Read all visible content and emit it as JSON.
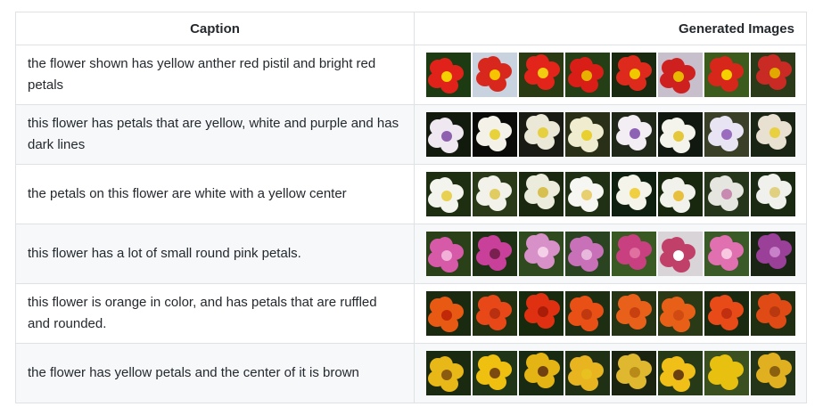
{
  "table": {
    "header_caption": "Caption",
    "header_images": "Generated Images",
    "rows": [
      {
        "caption": "the flower shown has yellow anther red pistil and bright red petals",
        "bg": [
          "#1d3b12",
          "#c9d3e0",
          "#2a3a12",
          "#243f15",
          "#1a2a10",
          "#c8bfcc",
          "#3b5c1c",
          "#2b3b1a"
        ],
        "petal": [
          "#e0221a",
          "#d8281e",
          "#e2241a",
          "#d81e16",
          "#dd2a1c",
          "#cf2020",
          "#d7261a",
          "#c92a24"
        ],
        "core": [
          "#f4d000",
          "#f6c400",
          "#f2cc10",
          "#e8b000",
          "#f0c800",
          "#e8b800",
          "#f4d000",
          "#e0a800"
        ]
      },
      {
        "caption": "this flower has petals that are yellow, white and purple and has dark lines",
        "bg": [
          "#121a0e",
          "#0a0a08",
          "#1a1a14",
          "#2a3018",
          "#20281a",
          "#101810",
          "#3a4028",
          "#1a2414"
        ],
        "petal": [
          "#efe8f0",
          "#f4f2e8",
          "#ece8d8",
          "#f0ecd0",
          "#f2eef4",
          "#f4f4ec",
          "#e8e4f4",
          "#e8e0d0"
        ],
        "core": [
          "#8f5fb0",
          "#e8d23a",
          "#e6d040",
          "#e8d030",
          "#8d62b4",
          "#e4c83a",
          "#9a6cc0",
          "#e8d040"
        ]
      },
      {
        "caption": "the petals on this flower are white with a yellow center",
        "bg": [
          "#1e2e10",
          "#2a3a18",
          "#1a2810",
          "#203014",
          "#102010",
          "#18280e",
          "#26361a",
          "#1a2a12"
        ],
        "petal": [
          "#f4f4ee",
          "#f2f2ea",
          "#ececdc",
          "#f6f6f2",
          "#f4f4ea",
          "#f2f2ec",
          "#e6e6e0",
          "#f0f0ec"
        ],
        "core": [
          "#e8d050",
          "#e0cc60",
          "#d8c050",
          "#e8d070",
          "#f0d040",
          "#e8c040",
          "#c88ab0",
          "#e0d080"
        ]
      },
      {
        "caption": "this flower has a lot of small round pink petals.",
        "bg": [
          "#2a4018",
          "#1e3014",
          "#304a20",
          "#2a4422",
          "#3a5a24",
          "#d8d4d8",
          "#3a5a28",
          "#1a2414"
        ],
        "petal": [
          "#d65aa8",
          "#c8409a",
          "#d890c8",
          "#c870b8",
          "#c84080",
          "#c0406a",
          "#e070b0",
          "#9a4098"
        ],
        "core": [
          "#f0b0d8",
          "#7a2050",
          "#f4d0e8",
          "#e8b8dc",
          "#e070a0",
          "#ffffff",
          "#f8c8e0",
          "#c880c8"
        ]
      },
      {
        "caption": "this flower is orange in color, and has petals that are ruffled and rounded.",
        "bg": [
          "#1a2a10",
          "#203010",
          "#182a0e",
          "#1e2e12",
          "#243414",
          "#2a3a16",
          "#1a2a10",
          "#202e12"
        ],
        "petal": [
          "#e85a14",
          "#e84818",
          "#e03012",
          "#e85016",
          "#e8601a",
          "#e86018",
          "#e84a18",
          "#e04a14"
        ],
        "core": [
          "#c02808",
          "#b83010",
          "#a81c08",
          "#c03810",
          "#c84010",
          "#d04a12",
          "#c03010",
          "#b83810"
        ]
      },
      {
        "caption": "the flower has yellow petals and the center of it is brown",
        "bg": [
          "#1a2a10",
          "#203418",
          "#182a12",
          "#203014",
          "#1a2410",
          "#263a18",
          "#3a5020",
          "#243418"
        ],
        "petal": [
          "#e8b818",
          "#f0c010",
          "#e4b414",
          "#e8b420",
          "#e0b830",
          "#f0c018",
          "#e8c010",
          "#e0b020"
        ],
        "core": [
          "#8a5a10",
          "#7a4a10",
          "#704010",
          "#e8c020",
          "#b88a18",
          "#6a4010",
          "#e8c010",
          "#8a6010"
        ]
      }
    ]
  }
}
